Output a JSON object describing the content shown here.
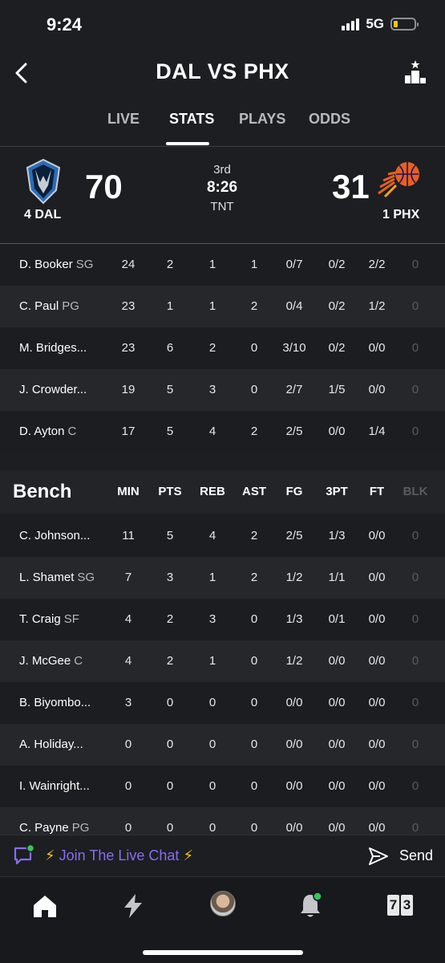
{
  "status_bar": {
    "time": "9:24",
    "network": "5G",
    "battery_level": 0.18
  },
  "nav": {
    "title": "DAL VS PHX"
  },
  "tabs": [
    {
      "label": "LIVE",
      "active": false
    },
    {
      "label": "STATS",
      "active": true
    },
    {
      "label": "PLAYS",
      "active": false
    },
    {
      "label": "ODDS",
      "active": false
    }
  ],
  "scoreboard": {
    "home": {
      "seed_abbr": "4 DAL",
      "score": "70"
    },
    "away": {
      "seed_abbr": "1 PHX",
      "score": "31"
    },
    "period": "3rd",
    "clock": "8:26",
    "network": "TNT"
  },
  "starters": [
    {
      "name": "D. Booker",
      "pos": "SG",
      "stats": [
        "24",
        "2",
        "1",
        "1",
        "0/7",
        "0/2",
        "2/2",
        "0"
      ]
    },
    {
      "name": "C. Paul",
      "pos": "PG",
      "stats": [
        "23",
        "1",
        "1",
        "2",
        "0/4",
        "0/2",
        "1/2",
        "0"
      ]
    },
    {
      "name": "M. Bridges...",
      "pos": "",
      "stats": [
        "23",
        "6",
        "2",
        "0",
        "3/10",
        "0/2",
        "0/0",
        "0"
      ]
    },
    {
      "name": "J. Crowder...",
      "pos": "",
      "stats": [
        "19",
        "5",
        "3",
        "0",
        "2/7",
        "1/5",
        "0/0",
        "0"
      ]
    },
    {
      "name": "D. Ayton",
      "pos": "C",
      "stats": [
        "17",
        "5",
        "4",
        "2",
        "2/5",
        "0/0",
        "1/4",
        "0"
      ]
    }
  ],
  "bench": {
    "title": "Bench",
    "columns": [
      "MIN",
      "PTS",
      "REB",
      "AST",
      "FG",
      "3PT",
      "FT",
      "BLK"
    ],
    "players": [
      {
        "name": "C. Johnson...",
        "pos": "",
        "stats": [
          "11",
          "5",
          "4",
          "2",
          "2/5",
          "1/3",
          "0/0",
          "0"
        ]
      },
      {
        "name": "L. Shamet",
        "pos": "SG",
        "stats": [
          "7",
          "3",
          "1",
          "2",
          "1/2",
          "1/1",
          "0/0",
          "0"
        ]
      },
      {
        "name": "T. Craig",
        "pos": "SF",
        "stats": [
          "4",
          "2",
          "3",
          "0",
          "1/3",
          "0/1",
          "0/0",
          "0"
        ]
      },
      {
        "name": "J. McGee",
        "pos": "C",
        "stats": [
          "4",
          "2",
          "1",
          "0",
          "1/2",
          "0/0",
          "0/0",
          "0"
        ]
      },
      {
        "name": "B. Biyombo...",
        "pos": "",
        "stats": [
          "3",
          "0",
          "0",
          "0",
          "0/0",
          "0/0",
          "0/0",
          "0"
        ]
      },
      {
        "name": "A. Holiday...",
        "pos": "",
        "stats": [
          "0",
          "0",
          "0",
          "0",
          "0/0",
          "0/0",
          "0/0",
          "0"
        ]
      },
      {
        "name": "I. Wainright...",
        "pos": "",
        "stats": [
          "0",
          "0",
          "0",
          "0",
          "0/0",
          "0/0",
          "0/0",
          "0"
        ]
      },
      {
        "name": "C. Payne",
        "pos": "PG",
        "stats": [
          "0",
          "0",
          "0",
          "0",
          "0/0",
          "0/0",
          "0/0",
          "0"
        ]
      }
    ]
  },
  "chat": {
    "bolt_left": "⚡",
    "label": "Join The Live Chat",
    "bolt_right": "⚡",
    "send_label": "Send"
  },
  "tab_bar": {
    "score_left": "7",
    "score_right": "3"
  },
  "colors": {
    "accent_purple": "#8a6cf0",
    "bolt_yellow": "#f5c518",
    "notify_green": "#34c759"
  }
}
